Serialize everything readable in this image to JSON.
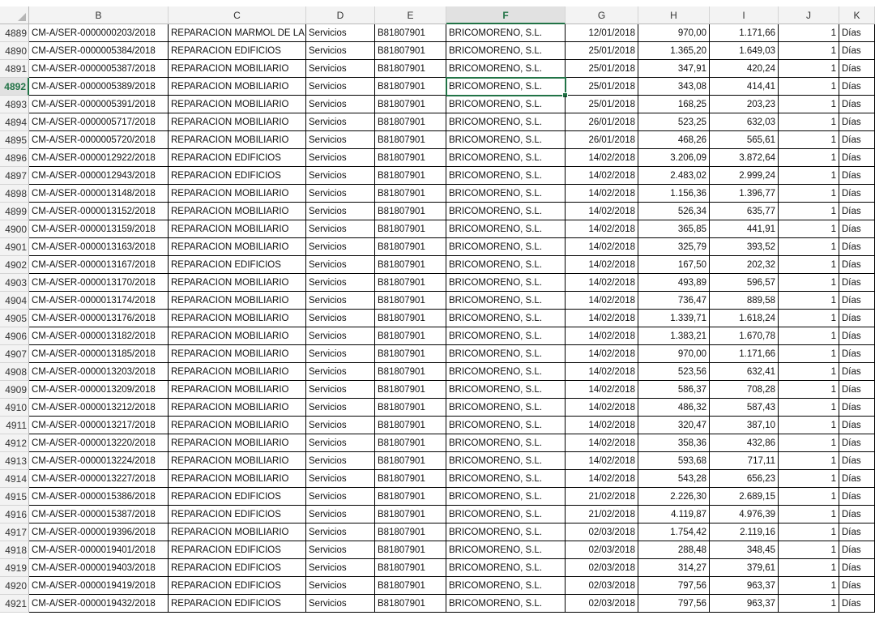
{
  "columns": [
    "B",
    "C",
    "D",
    "E",
    "F",
    "G",
    "H",
    "I",
    "J",
    "K"
  ],
  "selected_column": "F",
  "selected_row": "4892",
  "rows": [
    {
      "n": "4889",
      "b": "CM-A/SER-0000000203/2018",
      "c": "REPARACION MARMOL DE LA",
      "d": "Servicios",
      "e": "B81807901",
      "f": "BRICOMORENO, S.L.",
      "g": "12/01/2018",
      "h": "970,00",
      "i": "1.171,66",
      "j": "1",
      "k": "Días"
    },
    {
      "n": "4890",
      "b": "CM-A/SER-0000005384/2018",
      "c": "REPARACION EDIFICIOS",
      "d": "Servicios",
      "e": "B81807901",
      "f": "BRICOMORENO, S.L.",
      "g": "25/01/2018",
      "h": "1.365,20",
      "i": "1.649,03",
      "j": "1",
      "k": "Días"
    },
    {
      "n": "4891",
      "b": "CM-A/SER-0000005387/2018",
      "c": "REPARACION MOBILIARIO",
      "d": "Servicios",
      "e": "B81807901",
      "f": "BRICOMORENO, S.L.",
      "g": "25/01/2018",
      "h": "347,91",
      "i": "420,24",
      "j": "1",
      "k": "Días"
    },
    {
      "n": "4892",
      "b": "CM-A/SER-0000005389/2018",
      "c": "REPARACION MOBILIARIO",
      "d": "Servicios",
      "e": "B81807901",
      "f": "BRICOMORENO, S.L.",
      "g": "25/01/2018",
      "h": "343,08",
      "i": "414,41",
      "j": "1",
      "k": "Días"
    },
    {
      "n": "4893",
      "b": "CM-A/SER-0000005391/2018",
      "c": "REPARACION MOBILIARIO",
      "d": "Servicios",
      "e": "B81807901",
      "f": "BRICOMORENO, S.L.",
      "g": "25/01/2018",
      "h": "168,25",
      "i": "203,23",
      "j": "1",
      "k": "Días"
    },
    {
      "n": "4894",
      "b": "CM-A/SER-0000005717/2018",
      "c": "REPARACION MOBILIARIO",
      "d": "Servicios",
      "e": "B81807901",
      "f": "BRICOMORENO, S.L.",
      "g": "26/01/2018",
      "h": "523,25",
      "i": "632,03",
      "j": "1",
      "k": "Días"
    },
    {
      "n": "4895",
      "b": "CM-A/SER-0000005720/2018",
      "c": "REPARACION MOBILIARIO",
      "d": "Servicios",
      "e": "B81807901",
      "f": "BRICOMORENO, S.L.",
      "g": "26/01/2018",
      "h": "468,26",
      "i": "565,61",
      "j": "1",
      "k": "Días"
    },
    {
      "n": "4896",
      "b": "CM-A/SER-0000012922/2018",
      "c": "REPARACION EDIFICIOS",
      "d": "Servicios",
      "e": "B81807901",
      "f": "BRICOMORENO, S.L.",
      "g": "14/02/2018",
      "h": "3.206,09",
      "i": "3.872,64",
      "j": "1",
      "k": "Días"
    },
    {
      "n": "4897",
      "b": "CM-A/SER-0000012943/2018",
      "c": "REPARACION EDIFICIOS",
      "d": "Servicios",
      "e": "B81807901",
      "f": "BRICOMORENO, S.L.",
      "g": "14/02/2018",
      "h": "2.483,02",
      "i": "2.999,24",
      "j": "1",
      "k": "Días"
    },
    {
      "n": "4898",
      "b": "CM-A/SER-0000013148/2018",
      "c": "REPARACION MOBILIARIO",
      "d": "Servicios",
      "e": "B81807901",
      "f": "BRICOMORENO, S.L.",
      "g": "14/02/2018",
      "h": "1.156,36",
      "i": "1.396,77",
      "j": "1",
      "k": "Días"
    },
    {
      "n": "4899",
      "b": "CM-A/SER-0000013152/2018",
      "c": "REPARACION MOBILIARIO",
      "d": "Servicios",
      "e": "B81807901",
      "f": "BRICOMORENO, S.L.",
      "g": "14/02/2018",
      "h": "526,34",
      "i": "635,77",
      "j": "1",
      "k": "Días"
    },
    {
      "n": "4900",
      "b": "CM-A/SER-0000013159/2018",
      "c": "REPARACION MOBILIARIO",
      "d": "Servicios",
      "e": "B81807901",
      "f": "BRICOMORENO, S.L.",
      "g": "14/02/2018",
      "h": "365,85",
      "i": "441,91",
      "j": "1",
      "k": "Días"
    },
    {
      "n": "4901",
      "b": "CM-A/SER-0000013163/2018",
      "c": "REPARACION MOBILIARIO",
      "d": "Servicios",
      "e": "B81807901",
      "f": "BRICOMORENO, S.L.",
      "g": "14/02/2018",
      "h": "325,79",
      "i": "393,52",
      "j": "1",
      "k": "Días"
    },
    {
      "n": "4902",
      "b": "CM-A/SER-0000013167/2018",
      "c": "REPARACION EDIFICIOS",
      "d": "Servicios",
      "e": "B81807901",
      "f": "BRICOMORENO, S.L.",
      "g": "14/02/2018",
      "h": "167,50",
      "i": "202,32",
      "j": "1",
      "k": "Días"
    },
    {
      "n": "4903",
      "b": "CM-A/SER-0000013170/2018",
      "c": "REPARACION MOBILIARIO",
      "d": "Servicios",
      "e": "B81807901",
      "f": "BRICOMORENO, S.L.",
      "g": "14/02/2018",
      "h": "493,89",
      "i": "596,57",
      "j": "1",
      "k": "Días"
    },
    {
      "n": "4904",
      "b": "CM-A/SER-0000013174/2018",
      "c": "REPARACION MOBILIARIO",
      "d": "Servicios",
      "e": "B81807901",
      "f": "BRICOMORENO, S.L.",
      "g": "14/02/2018",
      "h": "736,47",
      "i": "889,58",
      "j": "1",
      "k": "Días"
    },
    {
      "n": "4905",
      "b": "CM-A/SER-0000013176/2018",
      "c": "REPARACION MOBILIARIO",
      "d": "Servicios",
      "e": "B81807901",
      "f": "BRICOMORENO, S.L.",
      "g": "14/02/2018",
      "h": "1.339,71",
      "i": "1.618,24",
      "j": "1",
      "k": "Días"
    },
    {
      "n": "4906",
      "b": "CM-A/SER-0000013182/2018",
      "c": "REPARACION MOBILIARIO",
      "d": "Servicios",
      "e": "B81807901",
      "f": "BRICOMORENO, S.L.",
      "g": "14/02/2018",
      "h": "1.383,21",
      "i": "1.670,78",
      "j": "1",
      "k": "Días"
    },
    {
      "n": "4907",
      "b": "CM-A/SER-0000013185/2018",
      "c": "REPARACION MOBILIARIO",
      "d": "Servicios",
      "e": "B81807901",
      "f": "BRICOMORENO, S.L.",
      "g": "14/02/2018",
      "h": "970,00",
      "i": "1.171,66",
      "j": "1",
      "k": "Días"
    },
    {
      "n": "4908",
      "b": "CM-A/SER-0000013203/2018",
      "c": "REPARACION MOBILIARIO",
      "d": "Servicios",
      "e": "B81807901",
      "f": "BRICOMORENO, S.L.",
      "g": "14/02/2018",
      "h": "523,56",
      "i": "632,41",
      "j": "1",
      "k": "Días"
    },
    {
      "n": "4909",
      "b": "CM-A/SER-0000013209/2018",
      "c": "REPARACION MOBILIARIO",
      "d": "Servicios",
      "e": "B81807901",
      "f": "BRICOMORENO, S.L.",
      "g": "14/02/2018",
      "h": "586,37",
      "i": "708,28",
      "j": "1",
      "k": "Días"
    },
    {
      "n": "4910",
      "b": "CM-A/SER-0000013212/2018",
      "c": "REPARACION MOBILIARIO",
      "d": "Servicios",
      "e": "B81807901",
      "f": "BRICOMORENO, S.L.",
      "g": "14/02/2018",
      "h": "486,32",
      "i": "587,43",
      "j": "1",
      "k": "Días"
    },
    {
      "n": "4911",
      "b": "CM-A/SER-0000013217/2018",
      "c": "REPARACION MOBILIARIO",
      "d": "Servicios",
      "e": "B81807901",
      "f": "BRICOMORENO, S.L.",
      "g": "14/02/2018",
      "h": "320,47",
      "i": "387,10",
      "j": "1",
      "k": "Días"
    },
    {
      "n": "4912",
      "b": "CM-A/SER-0000013220/2018",
      "c": "REPARACION MOBILIARIO",
      "d": "Servicios",
      "e": "B81807901",
      "f": "BRICOMORENO, S.L.",
      "g": "14/02/2018",
      "h": "358,36",
      "i": "432,86",
      "j": "1",
      "k": "Días"
    },
    {
      "n": "4913",
      "b": "CM-A/SER-0000013224/2018",
      "c": "REPARACION MOBILIARIO",
      "d": "Servicios",
      "e": "B81807901",
      "f": "BRICOMORENO, S.L.",
      "g": "14/02/2018",
      "h": "593,68",
      "i": "717,11",
      "j": "1",
      "k": "Días"
    },
    {
      "n": "4914",
      "b": "CM-A/SER-0000013227/2018",
      "c": "REPARACION MOBILIARIO",
      "d": "Servicios",
      "e": "B81807901",
      "f": "BRICOMORENO, S.L.",
      "g": "14/02/2018",
      "h": "543,28",
      "i": "656,23",
      "j": "1",
      "k": "Días"
    },
    {
      "n": "4915",
      "b": "CM-A/SER-0000015386/2018",
      "c": "REPARACION EDIFICIOS",
      "d": "Servicios",
      "e": "B81807901",
      "f": "BRICOMORENO, S.L.",
      "g": "21/02/2018",
      "h": "2.226,30",
      "i": "2.689,15",
      "j": "1",
      "k": "Días"
    },
    {
      "n": "4916",
      "b": "CM-A/SER-0000015387/2018",
      "c": "REPARACION EDIFICIOS",
      "d": "Servicios",
      "e": "B81807901",
      "f": "BRICOMORENO, S.L.",
      "g": "21/02/2018",
      "h": "4.119,87",
      "i": "4.976,39",
      "j": "1",
      "k": "Días"
    },
    {
      "n": "4917",
      "b": "CM-A/SER-0000019396/2018",
      "c": "REPARACION MOBILIARIO",
      "d": "Servicios",
      "e": "B81807901",
      "f": "BRICOMORENO, S.L.",
      "g": "02/03/2018",
      "h": "1.754,42",
      "i": "2.119,16",
      "j": "1",
      "k": "Días"
    },
    {
      "n": "4918",
      "b": "CM-A/SER-0000019401/2018",
      "c": "REPARACION EDIFICIOS",
      "d": "Servicios",
      "e": "B81807901",
      "f": "BRICOMORENO, S.L.",
      "g": "02/03/2018",
      "h": "288,48",
      "i": "348,45",
      "j": "1",
      "k": "Días"
    },
    {
      "n": "4919",
      "b": "CM-A/SER-0000019403/2018",
      "c": "REPARACION EDIFICIOS",
      "d": "Servicios",
      "e": "B81807901",
      "f": "BRICOMORENO, S.L.",
      "g": "02/03/2018",
      "h": "314,27",
      "i": "379,61",
      "j": "1",
      "k": "Días"
    },
    {
      "n": "4920",
      "b": "CM-A/SER-0000019419/2018",
      "c": "REPARACION EDIFICIOS",
      "d": "Servicios",
      "e": "B81807901",
      "f": "BRICOMORENO, S.L.",
      "g": "02/03/2018",
      "h": "797,56",
      "i": "963,37",
      "j": "1",
      "k": "Días"
    },
    {
      "n": "4921",
      "b": "CM-A/SER-0000019432/2018",
      "c": "REPARACION EDIFICIOS",
      "d": "Servicios",
      "e": "B81807901",
      "f": "BRICOMORENO, S.L.",
      "g": "02/03/2018",
      "h": "797,56",
      "i": "963,37",
      "j": "1",
      "k": "Días"
    }
  ]
}
